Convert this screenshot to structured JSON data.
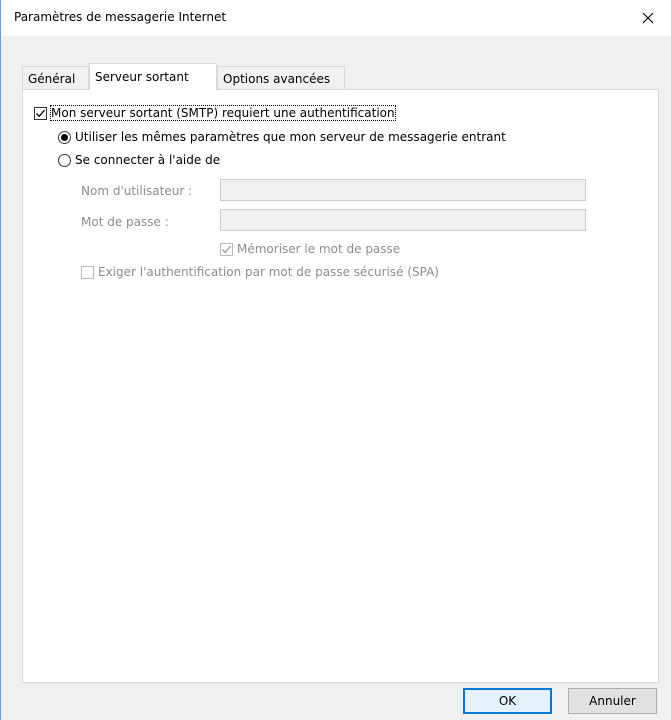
{
  "window": {
    "title": "Paramètres de messagerie Internet"
  },
  "tabs": [
    {
      "label": "Général",
      "active": false
    },
    {
      "label": "Serveur sortant",
      "active": true
    },
    {
      "label": "Options avancées",
      "active": false
    }
  ],
  "outgoing": {
    "smtp_auth_label": "Mon serveur sortant (SMTP) requiert une authentification",
    "smtp_auth_checked": true,
    "same_settings_label": "Utiliser les mêmes paramètres que mon serveur de messagerie entrant",
    "same_settings_selected": true,
    "login_with_label": "Se connecter à l'aide de",
    "login_with_selected": false,
    "username_label": "Nom d'utilisateur :",
    "username_value": "",
    "password_label": "Mot de passe :",
    "password_value": "",
    "remember_password_label": "Mémoriser le mot de passe",
    "remember_password_checked": true,
    "spa_label": "Exiger l'authentification par mot de passe sécurisé (SPA)",
    "spa_checked": false
  },
  "buttons": {
    "ok": "OK",
    "cancel": "Annuler"
  },
  "icons": {
    "close": "close-icon",
    "check": "checkmark-icon"
  },
  "colors": {
    "accent": "#0078d7",
    "disabled_text": "#8d8d8d"
  }
}
